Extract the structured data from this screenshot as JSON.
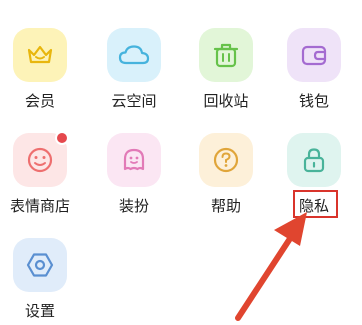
{
  "grid": {
    "items": [
      {
        "label": "会员",
        "icon": "crown-icon",
        "bg": "#fdf3b8",
        "color": "#e8b60d"
      },
      {
        "label": "云空间",
        "icon": "cloud-icon",
        "bg": "#d9f1fb",
        "color": "#46b3dd"
      },
      {
        "label": "回收站",
        "icon": "trash-icon",
        "bg": "#e2f6d8",
        "color": "#66c24a"
      },
      {
        "label": "钱包",
        "icon": "wallet-icon",
        "bg": "#efe3f8",
        "color": "#a46bd1"
      },
      {
        "label": "表情商店",
        "icon": "smiley-icon",
        "bg": "#fde6e6",
        "color": "#ee6f6f",
        "badge": true
      },
      {
        "label": "装扮",
        "icon": "ghost-icon",
        "bg": "#fbe6f3",
        "color": "#e27ab7"
      },
      {
        "label": "帮助",
        "icon": "help-icon",
        "bg": "#fdf0d9",
        "color": "#e0a53a"
      },
      {
        "label": "隐私",
        "icon": "lock-icon",
        "bg": "#dff4ef",
        "color": "#49b39a",
        "highlighted": true
      },
      {
        "label": "设置",
        "icon": "hexagon-gear-icon",
        "bg": "#e0ecfa",
        "color": "#5a8fd1"
      }
    ]
  },
  "annotation": {
    "highlight_color": "#d9342b",
    "arrow_color": "#e0452f"
  }
}
